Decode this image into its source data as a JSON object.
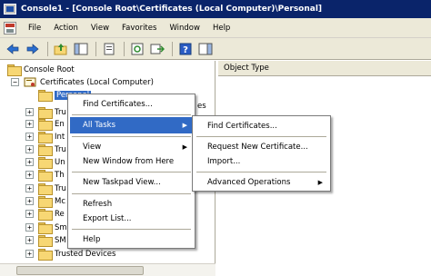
{
  "window": {
    "title": "Console1 - [Console Root\\Certificates (Local Computer)\\Personal]"
  },
  "menu": [
    "File",
    "Action",
    "View",
    "Favorites",
    "Window",
    "Help"
  ],
  "toolbar": {
    "icons": [
      "back-icon",
      "forward-icon",
      "up-folder-icon",
      "show-hide-tree-icon",
      "properties-icon",
      "refresh-icon",
      "export-icon",
      "help-icon",
      "action-pane-icon"
    ]
  },
  "tree": {
    "root": "Console Root",
    "certificates": "Certificates (Local Computer)",
    "personal": "Personal",
    "partial_items": [
      "Tru",
      "En",
      "Int",
      "Tru",
      "Un",
      "Th",
      "Tru",
      "Mc",
      "Re",
      "Sm",
      "SM"
    ],
    "trusted_devices": "Trusted Devices",
    "expander_minus": "−",
    "expander_plus": "+"
  },
  "list_header": {
    "object_type": "Object Type"
  },
  "context_menu": {
    "find_certificates": "Find Certificates...",
    "all_tasks": "All Tasks",
    "view": "View",
    "new_window": "New Window from Here",
    "new_taskpad": "New Taskpad View...",
    "refresh": "Refresh",
    "export_list": "Export List...",
    "help": "Help",
    "behind_text": "es"
  },
  "submenu": {
    "find_certificates": "Find Certificates...",
    "request_new": "Request New Certificate...",
    "import": "Import...",
    "advanced": "Advanced Operations"
  }
}
